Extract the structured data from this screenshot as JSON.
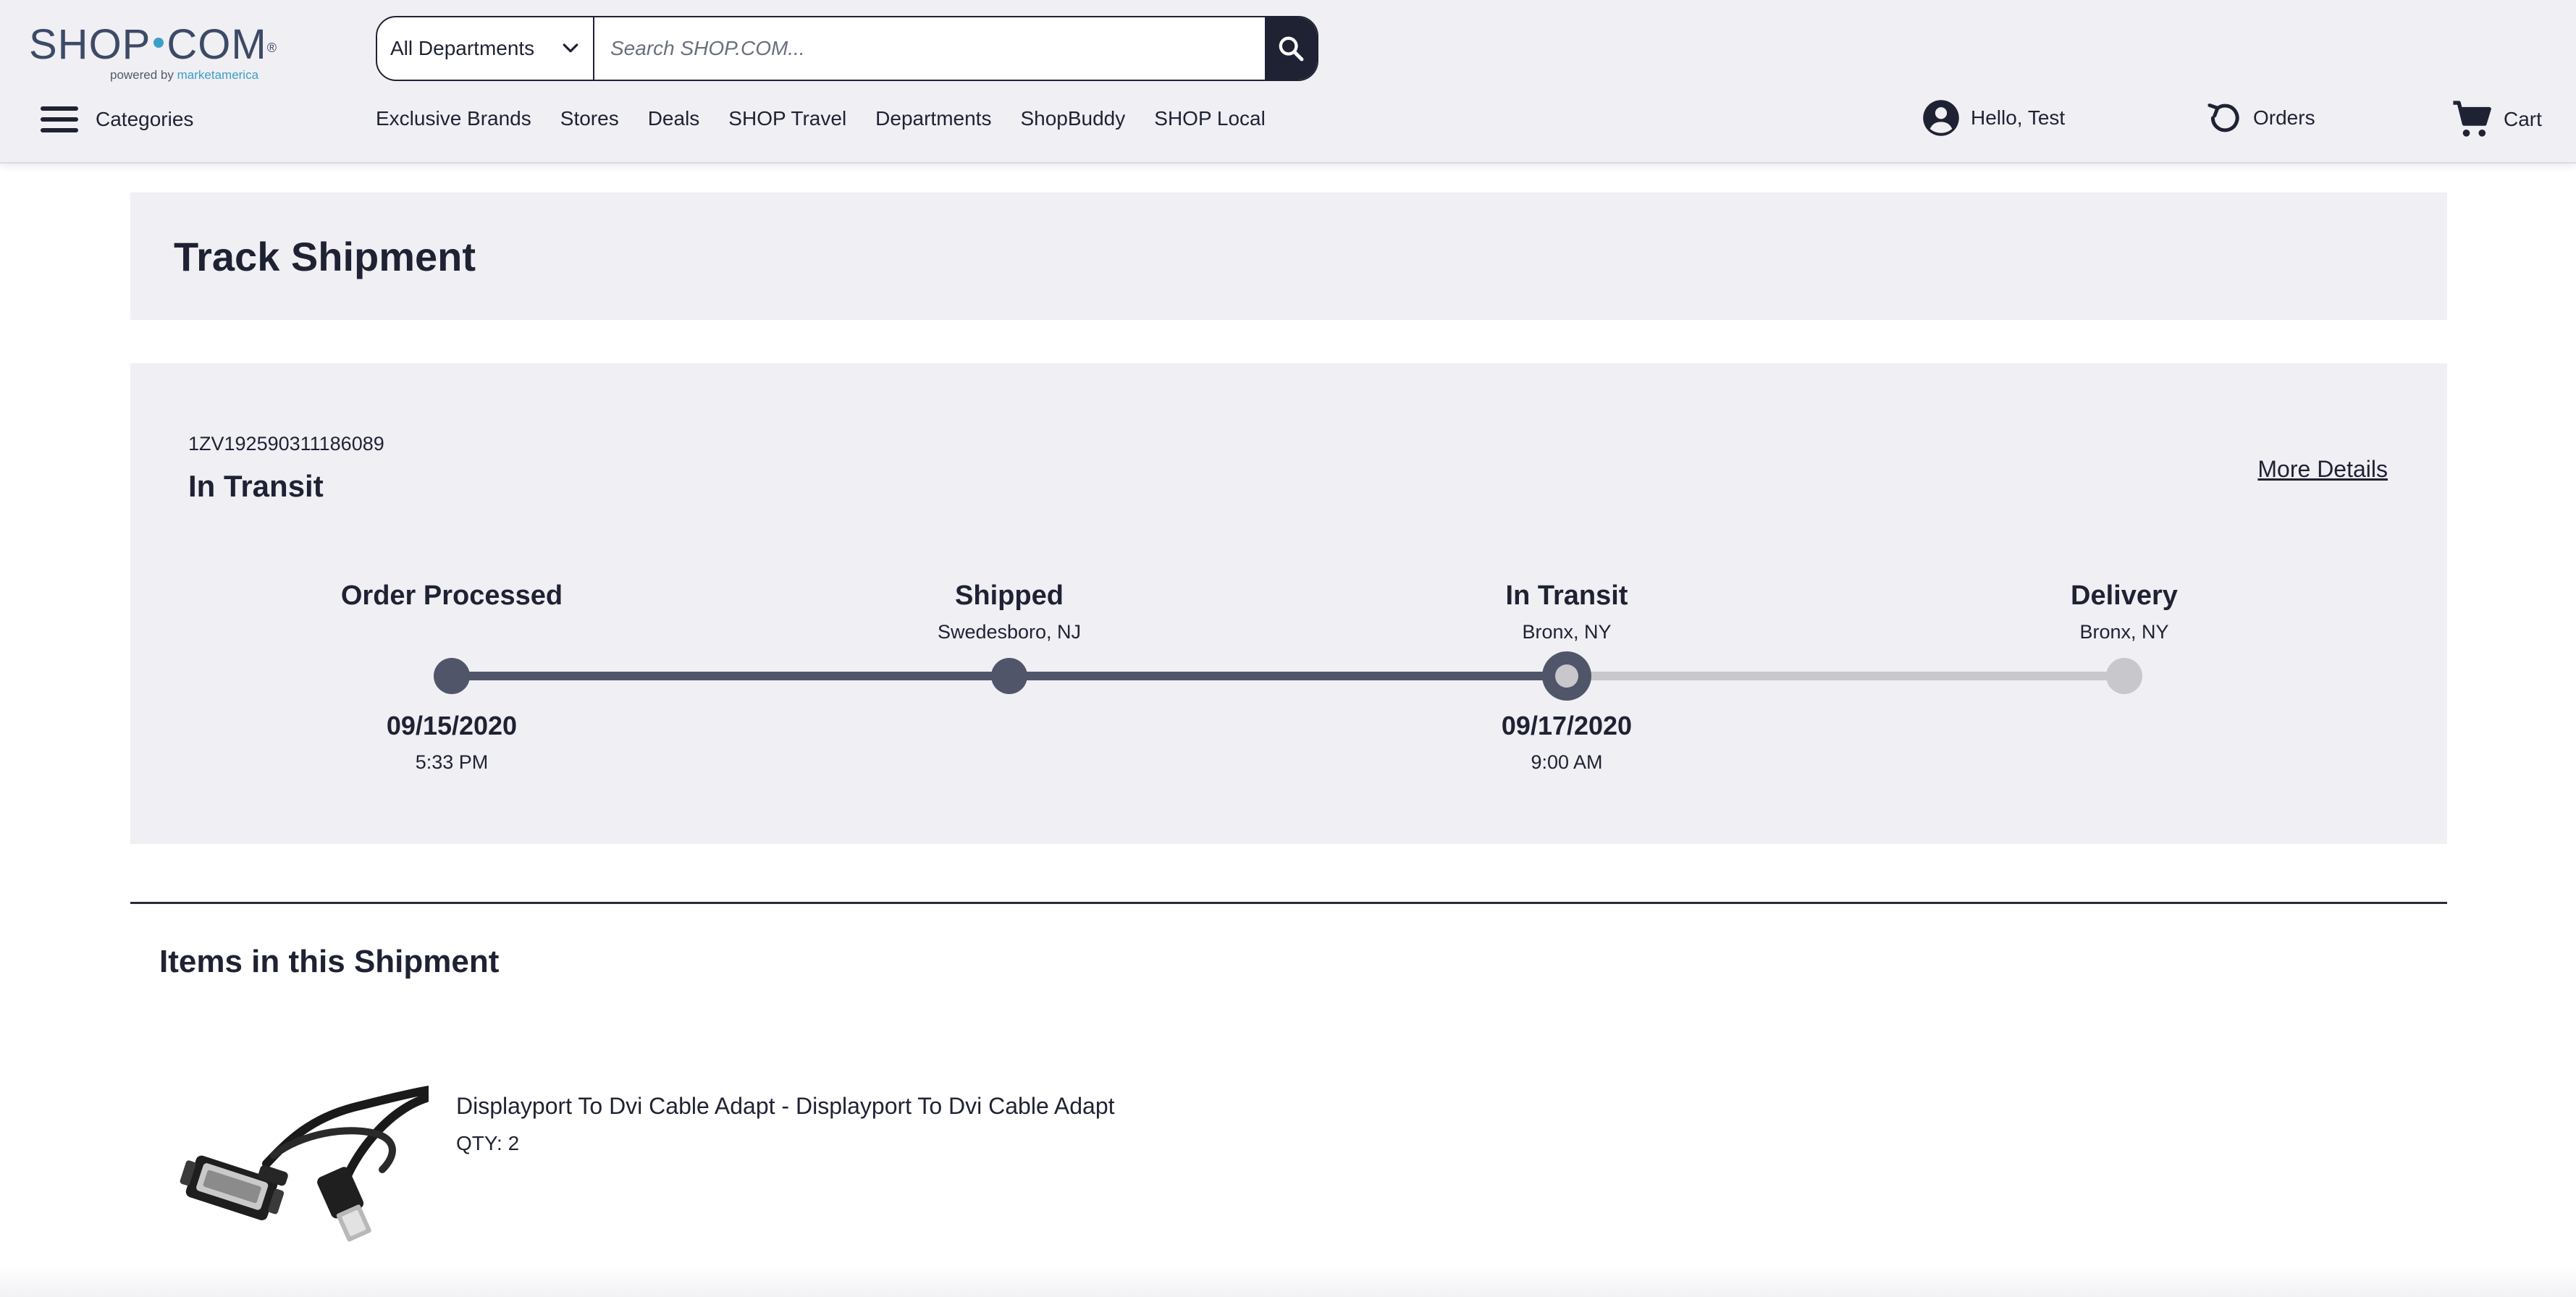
{
  "header": {
    "logo": {
      "main_left": "SHOP",
      "main_right": "COM",
      "trademark": "®",
      "sub_prefix": "powered by ",
      "sub_brand": "marketamerica"
    },
    "search": {
      "department": "All Departments",
      "placeholder": "Search SHOP.COM..."
    },
    "categories_label": "Categories",
    "nav": [
      {
        "label": "Exclusive Brands"
      },
      {
        "label": "Stores"
      },
      {
        "label": "Deals"
      },
      {
        "label": "SHOP Travel"
      },
      {
        "label": "Departments"
      },
      {
        "label": "ShopBuddy"
      },
      {
        "label": "SHOP Local"
      }
    ],
    "account_label": "Hello, Test",
    "orders_label": "Orders",
    "cart_label": "Cart"
  },
  "page_title": "Track Shipment",
  "shipment": {
    "tracking_number": "1ZV192590311186089",
    "status": "In Transit",
    "more_details": "More Details",
    "steps": [
      {
        "title": "Order Processed",
        "location": "",
        "date": "09/15/2020",
        "time": "5:33 PM",
        "state": "complete"
      },
      {
        "title": "Shipped",
        "location": "Swedesboro, NJ",
        "date": "",
        "time": "",
        "state": "complete"
      },
      {
        "title": "In Transit",
        "location": "Bronx, NY",
        "date": "09/17/2020",
        "time": "9:00 AM",
        "state": "current"
      },
      {
        "title": "Delivery",
        "location": "Bronx, NY",
        "date": "",
        "time": "",
        "state": "pending"
      }
    ]
  },
  "items_heading": "Items in this Shipment",
  "items": [
    {
      "name": "Displayport To Dvi Cable Adapt - Displayport To Dvi Cable Adapt",
      "qty": "QTY: 2",
      "image_icon": "dvi-cable-icon"
    }
  ],
  "colors": {
    "header_bg": "#efeff4",
    "dark": "#1f2233",
    "progress_done": "#515569",
    "progress_pending": "#c7c7cc",
    "brand_accent": "#3d9fc7"
  }
}
